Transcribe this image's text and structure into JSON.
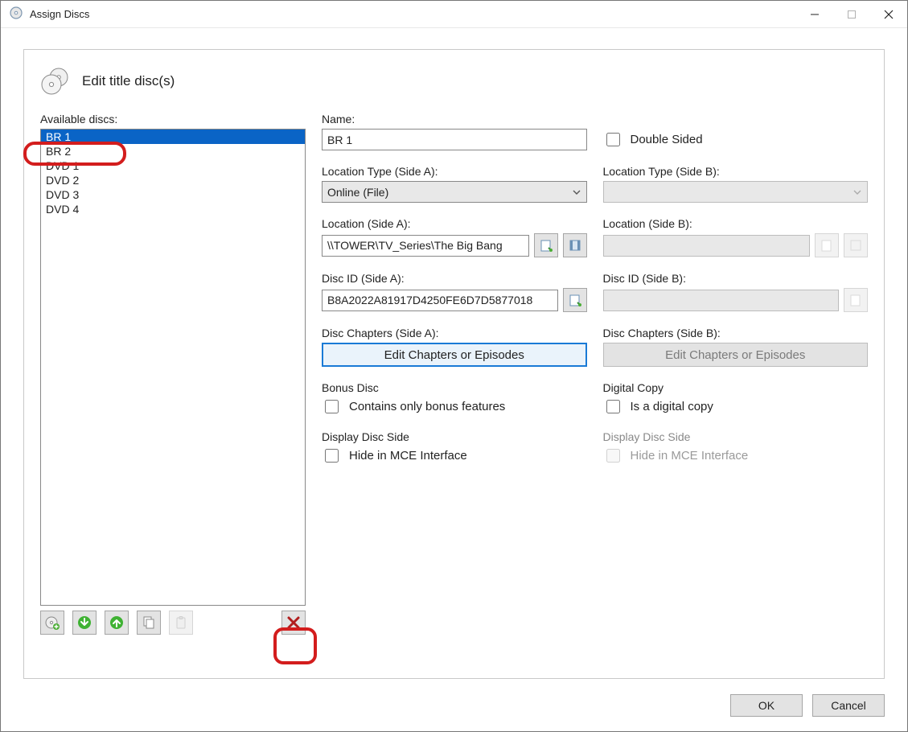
{
  "titlebar": {
    "title": "Assign Discs"
  },
  "header": {
    "text": "Edit title disc(s)"
  },
  "left": {
    "label": "Available discs:",
    "items": [
      "BR 1",
      "BR 2",
      "DVD 1",
      "DVD 2",
      "DVD 3",
      "DVD 4"
    ],
    "selected_index": 0
  },
  "form": {
    "nameLabel": "Name:",
    "name": "BR 1",
    "doubleSidedLabel": "Double Sided",
    "sideA": {
      "locTypeLabel": "Location Type (Side A):",
      "locType": "Online (File)",
      "locLabel": "Location (Side A):",
      "loc": "\\\\TOWER\\TV_Series\\The Big Bang",
      "discIdLabel": "Disc ID (Side A):",
      "discId": "B8A2022A81917D4250FE6D7D5877018",
      "chaptersLabel": "Disc Chapters (Side A):",
      "chaptersBtn": "Edit Chapters or Episodes",
      "bonusHeading": "Bonus Disc",
      "bonusLabel": "Contains only bonus features",
      "sideDisplayHeading": "Display Disc Side",
      "sideDisplayLabel": "Hide in MCE Interface"
    },
    "sideB": {
      "locTypeLabel": "Location Type (Side B):",
      "locLabel": "Location (Side B):",
      "discIdLabel": "Disc ID (Side B):",
      "chaptersLabel": "Disc Chapters (Side B):",
      "chaptersBtn": "Edit Chapters or Episodes",
      "digitalHeading": "Digital Copy",
      "digitalLabel": "Is a digital copy",
      "sideDisplayHeading": "Display Disc Side",
      "sideDisplayLabel": "Hide in MCE Interface"
    }
  },
  "buttons": {
    "ok": "OK",
    "cancel": "Cancel"
  }
}
